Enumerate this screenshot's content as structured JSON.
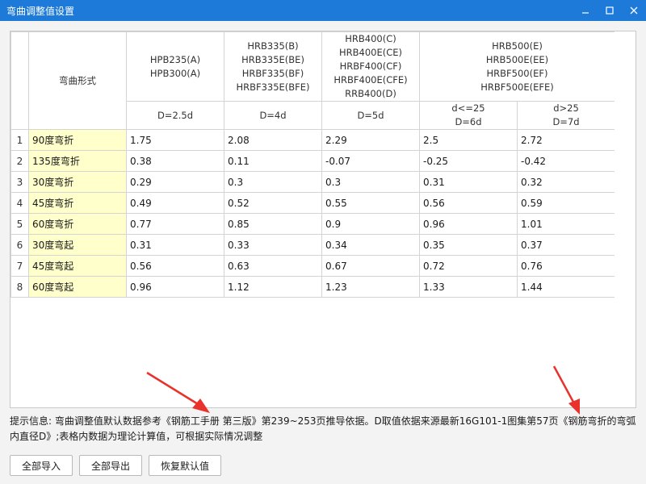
{
  "window": {
    "title": "弯曲调整值设置",
    "minimize_glyph": "—",
    "maximize_glyph": "□",
    "close_glyph": "✕"
  },
  "table": {
    "form_header": "弯曲形式",
    "groups": [
      {
        "lines": [
          "HPB235(A)",
          "HPB300(A)"
        ],
        "sub": [
          "D=2.5d"
        ]
      },
      {
        "lines": [
          "HRB335(B)",
          "HRB335E(BE)",
          "HRBF335(BF)",
          "HRBF335E(BFE)"
        ],
        "sub": [
          "D=4d"
        ]
      },
      {
        "lines": [
          "HRB400(C)",
          "HRB400E(CE)",
          "HRBF400(CF)",
          "HRBF400E(CFE)",
          "RRB400(D)"
        ],
        "sub": [
          "D=5d"
        ]
      },
      {
        "lines": [
          "HRB500(E)",
          "HRB500E(EE)",
          "HRBF500(EF)",
          "HRBF500E(EFE)"
        ],
        "sub": [
          "d<=25\nD=6d",
          "d>25\nD=7d"
        ]
      }
    ],
    "rows": [
      {
        "index": "1",
        "form": "90度弯折",
        "values": [
          "1.75",
          "2.08",
          "2.29",
          "2.5",
          "2.72"
        ]
      },
      {
        "index": "2",
        "form": "135度弯折",
        "values": [
          "0.38",
          "0.11",
          "-0.07",
          "-0.25",
          "-0.42"
        ]
      },
      {
        "index": "3",
        "form": "30度弯折",
        "values": [
          "0.29",
          "0.3",
          "0.3",
          "0.31",
          "0.32"
        ]
      },
      {
        "index": "4",
        "form": "45度弯折",
        "values": [
          "0.49",
          "0.52",
          "0.55",
          "0.56",
          "0.59"
        ]
      },
      {
        "index": "5",
        "form": "60度弯折",
        "values": [
          "0.77",
          "0.85",
          "0.9",
          "0.96",
          "1.01"
        ]
      },
      {
        "index": "6",
        "form": "30度弯起",
        "values": [
          "0.31",
          "0.33",
          "0.34",
          "0.35",
          "0.37"
        ]
      },
      {
        "index": "7",
        "form": "45度弯起",
        "values": [
          "0.56",
          "0.63",
          "0.67",
          "0.72",
          "0.76"
        ]
      },
      {
        "index": "8",
        "form": "60度弯起",
        "values": [
          "0.96",
          "1.12",
          "1.23",
          "1.33",
          "1.44"
        ]
      }
    ]
  },
  "hint": {
    "text": "提示信息: 弯曲调整值默认数据参考《钢筋工手册 第三版》第239~253页推导依据。D取值依据来源最新16G101-1图集第57页《钢筋弯折的弯弧内直径D》;表格内数据为理论计算值，可根据实际情况调整"
  },
  "buttons": {
    "import_all": "全部导入",
    "export_all": "全部导出",
    "restore_default": "恢复默认值"
  },
  "colors": {
    "titlebar": "#1d7ad8",
    "form_cell": "#ffffcc",
    "arrow": "#e8322b"
  }
}
